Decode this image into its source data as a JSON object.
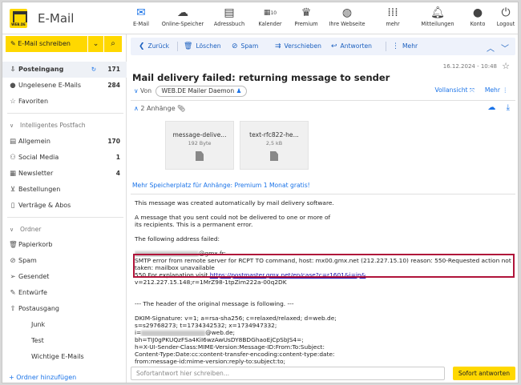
{
  "app": {
    "title": "E-Mail",
    "logo_text": "WEB.DE"
  },
  "nav": [
    {
      "label": "E-Mail",
      "icon": "envelope-icon"
    },
    {
      "label": "Online-Speicher",
      "icon": "cloud-icon"
    },
    {
      "label": "Adressbuch",
      "icon": "addressbook-icon"
    },
    {
      "label": "Kalender",
      "icon": "calendar-icon",
      "badge": "10"
    },
    {
      "label": "Premium",
      "icon": "crown-icon"
    },
    {
      "label": "Ihre Webseite",
      "icon": "globe-icon"
    },
    {
      "label": "mehr",
      "icon": "grid-icon"
    },
    {
      "label": "Mitteilungen",
      "icon": "bell-icon"
    },
    {
      "label": "Konto",
      "icon": "user-icon"
    },
    {
      "label": "Logout",
      "icon": "power-icon"
    }
  ],
  "sidebar": {
    "compose_label": "E-Mail schreiben",
    "folders": [
      {
        "label": "Posteingang",
        "count": "171"
      },
      {
        "label": "Ungelesene E-Mails",
        "count": "284"
      },
      {
        "label": "Favoriten",
        "count": ""
      }
    ],
    "smart_section": "Intelligentes Postfach",
    "smart": [
      {
        "label": "Allgemein",
        "count": "170"
      },
      {
        "label": "Social Media",
        "count": "1"
      },
      {
        "label": "Newsletter",
        "count": "4"
      },
      {
        "label": "Bestellungen",
        "count": ""
      },
      {
        "label": "Verträge & Abos",
        "count": ""
      }
    ],
    "folder_section": "Ordner",
    "ordner": [
      {
        "label": "Papierkorb"
      },
      {
        "label": "Spam"
      },
      {
        "label": "Gesendet"
      },
      {
        "label": "Entwürfe"
      },
      {
        "label": "Postausgang"
      },
      {
        "label": "Junk"
      },
      {
        "label": "Test"
      },
      {
        "label": "Wichtige E-Mails"
      }
    ],
    "add_folder": "Ordner hinzufügen"
  },
  "toolbar": {
    "back": "Zurück",
    "delete": "Löschen",
    "spam": "Spam",
    "move": "Verschieben",
    "reply": "Antworten",
    "more": "Mehr"
  },
  "message": {
    "date": "16.12.2024 - 10:48",
    "subject": "Mail delivery failed: returning message to sender",
    "from_prefix": "Von",
    "from_name": "WEB.DE Mailer Daemon",
    "full_view": "Vollansicht",
    "more": "Mehr",
    "attachments_label": "2 Anhänge",
    "attachments": [
      {
        "name": "message-delive...",
        "size": "192 Byte"
      },
      {
        "name": "text-rfc822-he...",
        "size": "2,5 kB"
      }
    ],
    "promo": "Mehr Speicherplatz für Anhänge: Premium 1 Monat gratis!",
    "body_lines": [
      "This message was created automatically by mail delivery software.",
      "",
      "A message that you sent could not be delivered to one or more of",
      "its recipients. This is a permanent error.",
      "",
      "The following address failed:",
      "",
      "@gmx.fr:",
      "SMTP error from remote server for RCPT TO command, host: mx00.gmx.net (212.227.15.10) reason: 550-Requested action not",
      "taken: mailbox unavailable",
      "550 For explanation visit ",
      "v=212.227.15.148;r=1MrZ98-1tpZim222a-00q2DK",
      "",
      "",
      "--- The header of the original message is following. ---",
      "",
      "DKIM-Signature: v=1; a=rsa-sha256; c=relaxed/relaxed; d=web.de;",
      "s=s29768273; t=1734342532; x=1734947332;",
      "@web.de;",
      "bh=TIJ0gPKUQzFSa4KiI6wzAwUsDY8BDGhaoEjCpSbJS4=;",
      "h=X-UI-Sender-Class:MIME-Version:Message-ID:From:To:Subject:",
      "Content-Type:Date:cc:content-transfer-encoding:content-type:date:",
      "from:message-id:mime-version:reply-to:subject:to;"
    ],
    "explanation_link": "https://postmaster.gmx.net/en/case?c=r1601&i=ip&"
  },
  "reply_placeholder": "Sofortantwort hier schreiben...",
  "send_label": "Sofort antworten"
}
